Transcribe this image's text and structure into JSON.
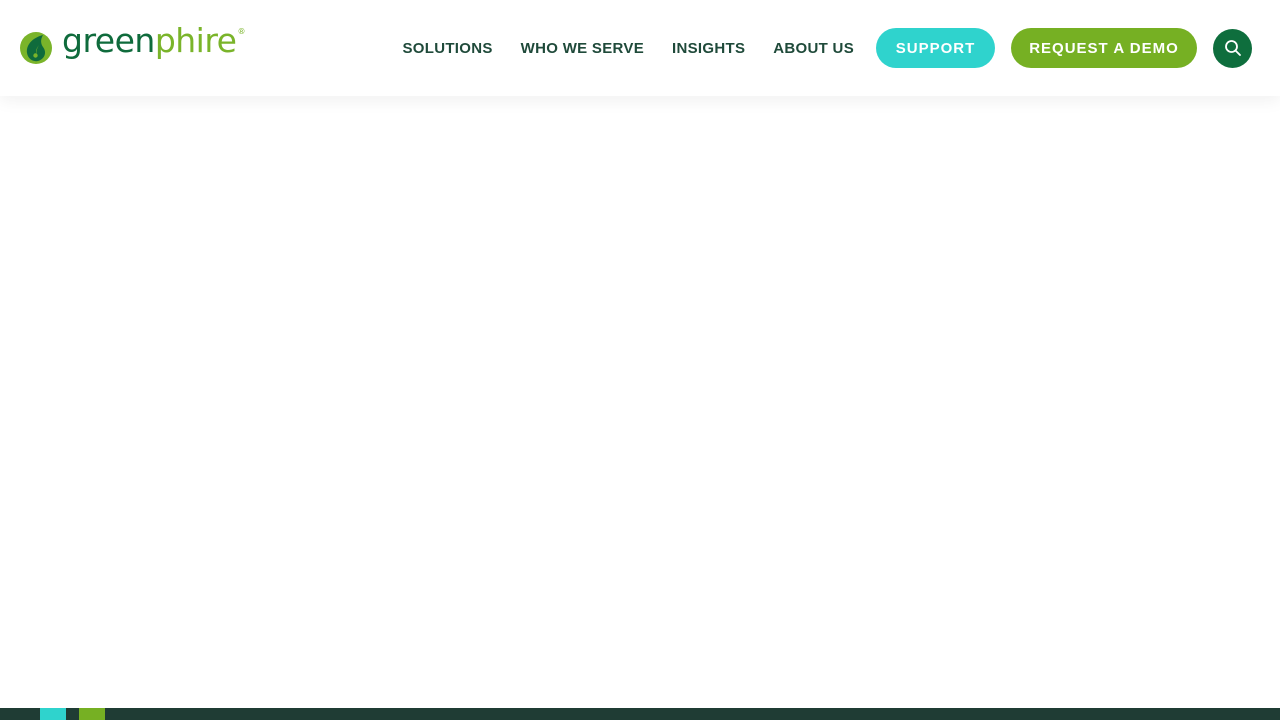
{
  "brand": {
    "name_part1": "green",
    "name_part2": "phire",
    "registered": "®",
    "colors": {
      "dark_green": "#0f6b3c",
      "light_green": "#7ab42a",
      "teal": "#2fd3cd",
      "footer": "#1f3c34"
    }
  },
  "nav": {
    "items": [
      {
        "label": "SOLUTIONS"
      },
      {
        "label": "WHO WE SERVE"
      },
      {
        "label": "INSIGHTS"
      },
      {
        "label": "ABOUT US"
      }
    ],
    "support_label": "SUPPORT",
    "demo_label": "REQUEST A DEMO",
    "search_icon": "search-icon"
  }
}
